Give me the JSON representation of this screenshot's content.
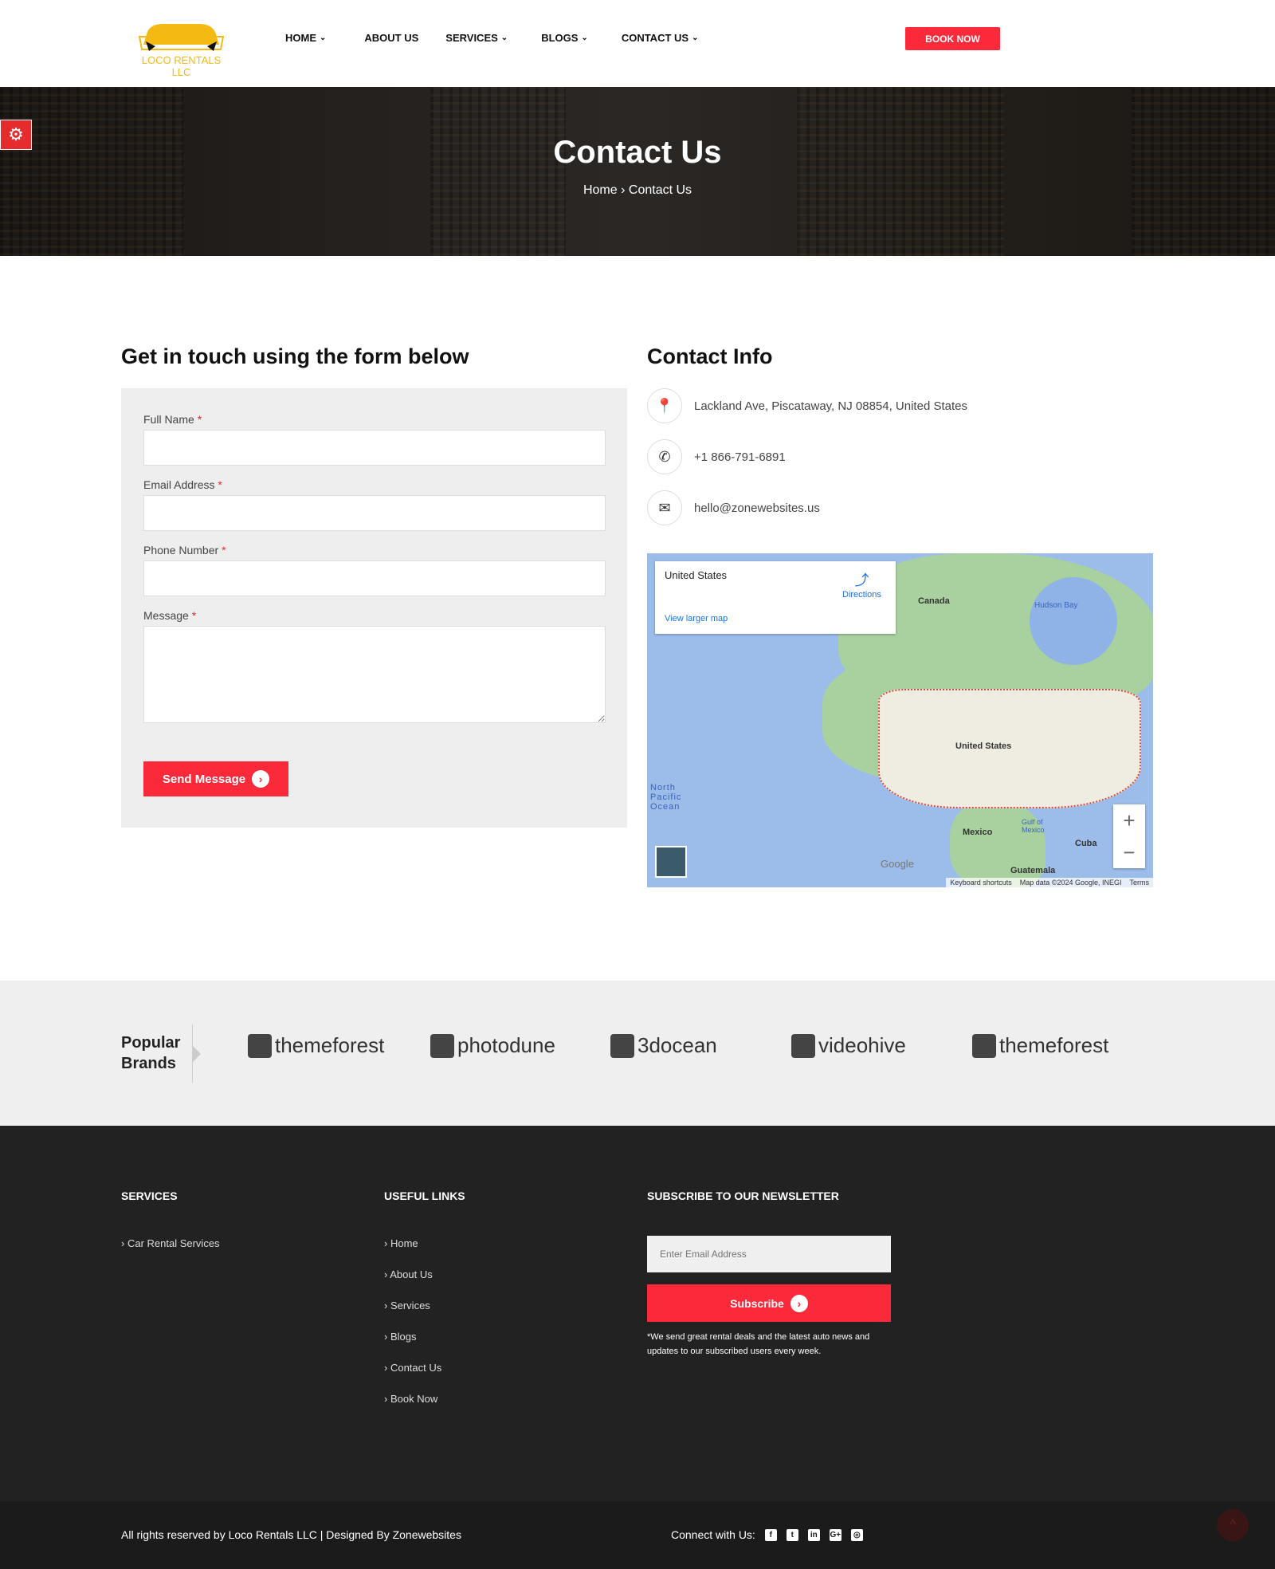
{
  "header": {
    "logo_text": "LOCO RENTALS LLC",
    "nav": [
      {
        "label": "HOME",
        "chevron": true
      },
      {
        "label": "ABOUT US",
        "chevron": false
      },
      {
        "label": "SERVICES",
        "chevron": true
      },
      {
        "label": "BLOGS",
        "chevron": true
      },
      {
        "label": "CONTACT US",
        "chevron": true
      }
    ],
    "book_now": "BOOK NOW"
  },
  "hero": {
    "title": "Contact Us",
    "breadcrumb": [
      "Home",
      "Contact Us"
    ]
  },
  "form": {
    "heading": "Get in touch using the form below",
    "fields": [
      {
        "label": "Full Name",
        "required": "*",
        "value": ""
      },
      {
        "label": "Email Address",
        "required": "*",
        "value": ""
      },
      {
        "label": "Phone Number",
        "required": "*",
        "value": ""
      },
      {
        "label": "Message",
        "required": "*",
        "value": ""
      }
    ],
    "submit": "Send Message"
  },
  "contact": {
    "heading": "Contact Info",
    "address": "Lackland Ave, Piscataway, NJ 08854, United States",
    "phone": "+1 866-791-6891",
    "email": "hello@zonewebsites.us"
  },
  "map": {
    "place": "United States",
    "directions": "Directions",
    "larger": "View larger map",
    "labels": {
      "canada": "Canada",
      "us": "United States",
      "mexico": "Mexico",
      "hudson": "Hudson Bay",
      "pacific": "North Pacific Ocean",
      "gulf": "Gulf of Mexico",
      "cuba": "Cuba",
      "guatemala": "Guatemala"
    },
    "attribution": [
      "Keyboard shortcuts",
      "Map data ©2024 Google, INEGI",
      "Terms"
    ],
    "google": "Google"
  },
  "brands": {
    "label": "Popular Brands",
    "items": [
      "themeforest",
      "photodune",
      "3docean",
      "videohive",
      "themeforest"
    ]
  },
  "footer": {
    "services_heading": "SERVICES",
    "services": [
      "Car Rental Services"
    ],
    "links_heading": "USEFUL LINKS",
    "links": [
      "Home",
      "About Us",
      "Services",
      "Blogs",
      "Contact Us",
      "Book Now"
    ],
    "newsletter_heading": "SUBSCRIBE TO OUR NEWSLETTER",
    "email_placeholder": "Enter Email Address",
    "subscribe": "Subscribe",
    "note": "*We send great rental deals and the latest auto news and updates to our subscribed users every week."
  },
  "bottom": {
    "copyright": "All rights reserved by Loco Rentals LLC | Designed By Zonewebsites",
    "connect": "Connect with Us:",
    "social": [
      "facebook-icon",
      "twitter-icon",
      "linkedin-icon",
      "google-plus-icon",
      "instagram-icon"
    ]
  },
  "colors": {
    "accent": "#fb2a3a",
    "logo": "#f5b914",
    "footer": "#222222"
  }
}
